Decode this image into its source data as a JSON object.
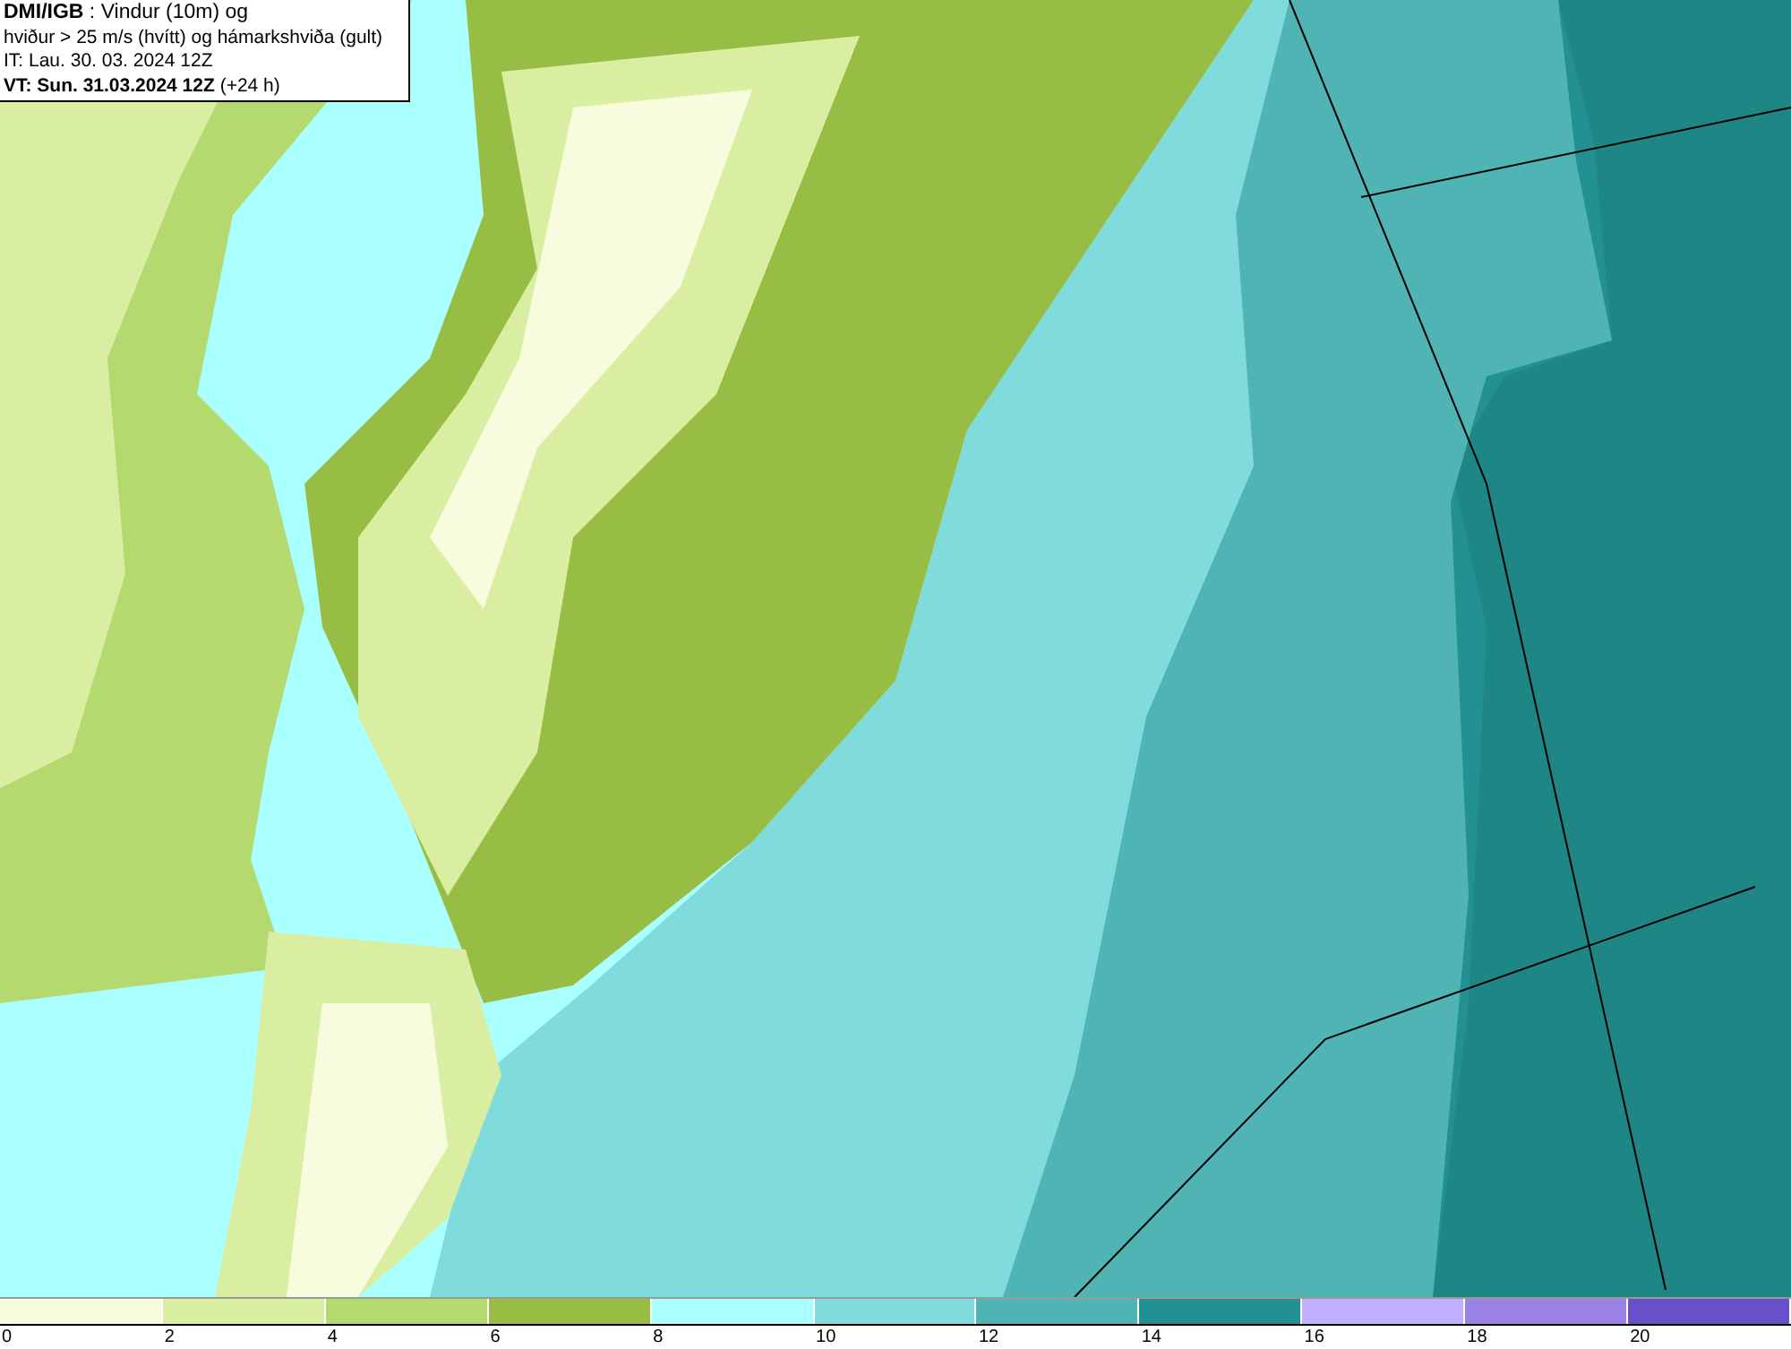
{
  "title_box": {
    "lines": [
      "**DMI/IGB** : Vindur (10m) og",
      "hviður > 25 m/s (hvítt) og hámarkshviða (gult)",
      "IT: Lau. 30. 03. 2024 12Z",
      "**VT: Sun. 31.03.2024 12Z** (+24 h)"
    ]
  },
  "legend": {
    "segments": [
      {
        "color": "#f7fcdf"
      },
      {
        "color": "#d9eea0"
      },
      {
        "color": "#b4d96f"
      },
      {
        "color": "#98bd45"
      },
      {
        "color": "#aaffff"
      },
      {
        "color": "#80dcdc"
      },
      {
        "color": "#50b4b4"
      },
      {
        "color": "#239191"
      },
      {
        "color": "#c0b0ff"
      },
      {
        "color": "#9a82e6"
      },
      {
        "color": "#6a50c8"
      }
    ],
    "labels": [
      "0",
      "2",
      "4",
      "6",
      "8",
      "10",
      "12",
      "14",
      "16",
      "18",
      "20"
    ]
  }
}
